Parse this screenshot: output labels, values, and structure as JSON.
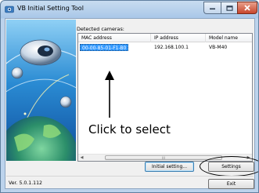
{
  "window": {
    "title": "VB Initial Setting Tool",
    "controls": {
      "minimize": "",
      "maximize": "",
      "close": "X"
    }
  },
  "main": {
    "detected_label": "Detected cameras:",
    "table": {
      "headers": [
        "MAC address",
        "IP address",
        "Model name"
      ],
      "rows": [
        {
          "mac": "00-00-85-01-F1-B0",
          "ip": "192.168.100.1",
          "model": "VB-M40"
        }
      ],
      "scrollbar_thumb": "III"
    },
    "annotation": "Click to select"
  },
  "buttons": {
    "initial_setting": "Initial setting...",
    "settings": "Settings",
    "exit": "Exit"
  },
  "footer": {
    "version": "Ver. 5.0.1.112"
  },
  "colors": {
    "selection": "#3399ff",
    "title_bar": "#a9c7e8",
    "close_button": "#c7452c",
    "illustration_bg": "#2b8cd6"
  }
}
